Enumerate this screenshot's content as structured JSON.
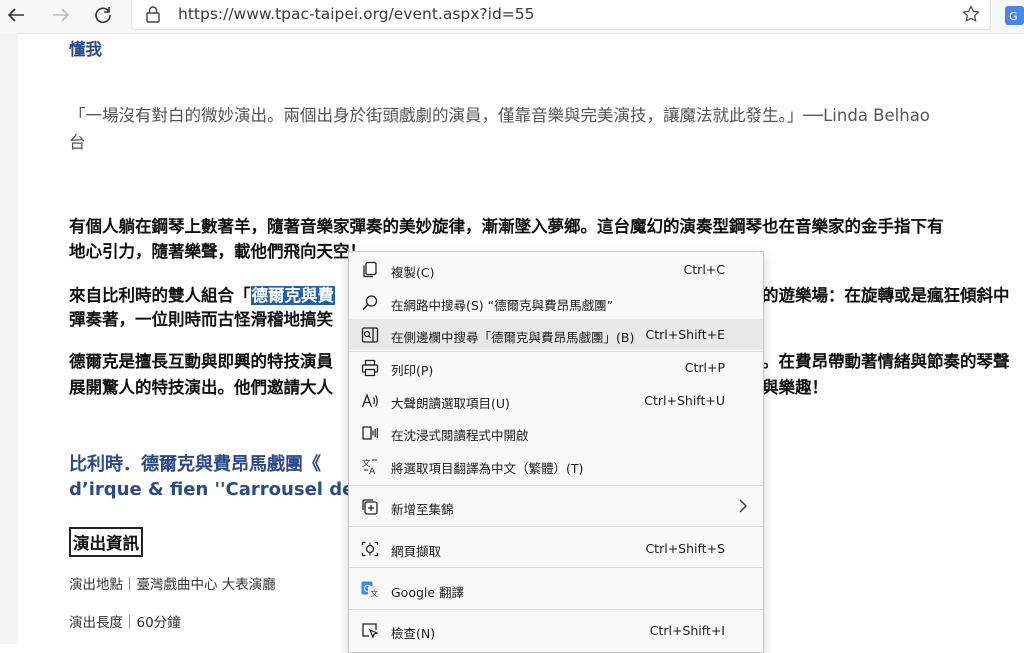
{
  "browser": {
    "url": "https://www.tpac-taipei.org/event.aspx?id=55"
  },
  "page": {
    "top_heading": "懂我",
    "quote_line1": "「一場沒有對白的微妙演出。兩個出身於街頭戲劇的演員，僅靠音樂與完美演技，讓魔法就此發生。」──Linda Belhao",
    "quote_line2": "台",
    "para1_line1": "有個人躺在鋼琴上數著羊，隨著音樂家彈奏的美妙旋律，漸漸墜入夢鄉。這台魔幻的演奏型鋼琴也在音樂家的金手指下有",
    "para1_line2": "地心引力，隨著樂聲，載他們飛向天空！",
    "para2_line1_a": "來自比利時的雙人組合「",
    "para2_highlight": "德爾克與費",
    "para2_line1_b": "的遊樂場：在旋轉或是瘋狂傾斜中",
    "para2_line2": "彈奏著，一位則時而古怪滑稽地搞笑",
    "para3_line1_a": "德爾克是擅長互動與即興的特技演員",
    "para3_line1_b": "。在費昂帶動著情緒與節奏的琴聲",
    "para3_line2_a": "展開驚人的特技演出。他們邀請大人",
    "para3_line2_b": "與樂趣！",
    "show_title_line1": "比利時．德爾克與費昂馬戲團《",
    "show_title_line2": "d’irque & fien ''Carrousel des N",
    "info_box": "演出資訊",
    "venue": "演出地點｜臺灣戲曲中心 大表演廳",
    "duration": "演出長度｜60分鐘"
  },
  "context_menu": {
    "items": [
      {
        "icon": "copy-icon",
        "label": "複製(C)",
        "shortcut": "Ctrl+C"
      },
      {
        "icon": "search-icon",
        "label": "在網路中搜尋(S) “德爾克與費昂馬戲團”",
        "shortcut": ""
      },
      {
        "icon": "sidebar-search-icon",
        "label": "在側邊欄中搜尋「德爾克與費昂馬戲團」(B)",
        "shortcut": "Ctrl+Shift+E"
      },
      {
        "icon": "print-icon",
        "label": "列印(P)",
        "shortcut": "Ctrl+P"
      },
      {
        "icon": "read-aloud-icon",
        "label": "大聲朗讀選取項目(U)",
        "shortcut": "Ctrl+Shift+U"
      },
      {
        "icon": "immersive-reader-icon",
        "label": "在沈浸式閱讀程式中開啟",
        "shortcut": ""
      },
      {
        "icon": "translate-icon",
        "label": "將選取項目翻譯為中文（繁體）(T)",
        "shortcut": ""
      },
      {
        "icon": "collections-icon",
        "label": "新增至集錦",
        "shortcut": ""
      },
      {
        "icon": "web-capture-icon",
        "label": "網頁擷取",
        "shortcut": "Ctrl+Shift+S"
      },
      {
        "icon": "google-translate-icon",
        "label": "Google 翻譯",
        "shortcut": ""
      },
      {
        "icon": "inspect-icon",
        "label": "檢查(N)",
        "shortcut": "Ctrl+Shift+I"
      }
    ]
  }
}
